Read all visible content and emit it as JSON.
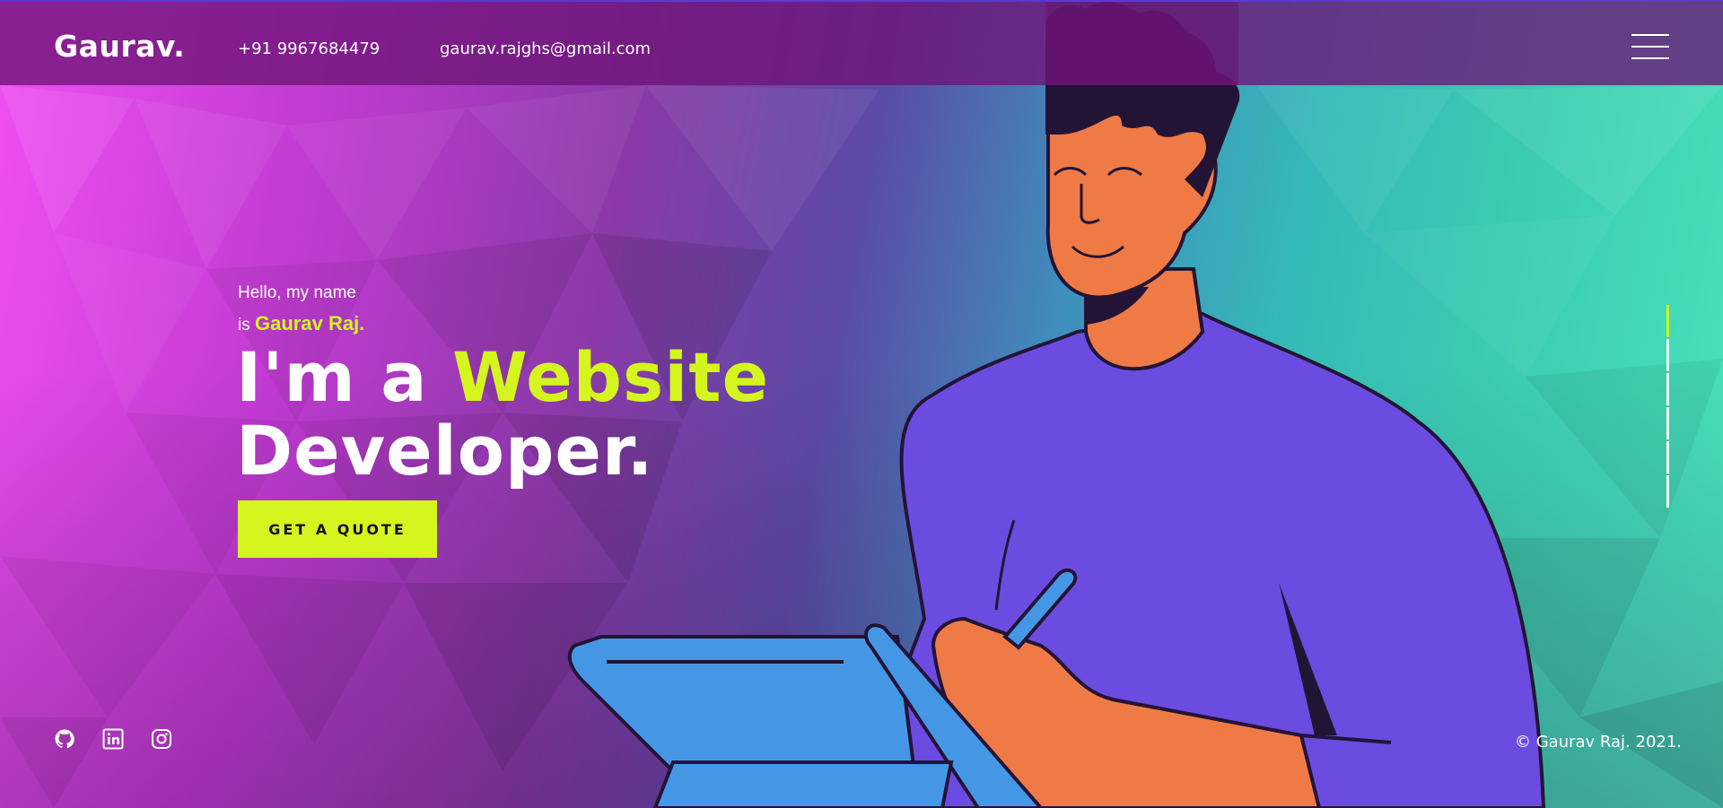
{
  "header": {
    "logo": "Gaurav.",
    "phone": "+91 9967684479",
    "email": "gaurav.rajghs@gmail.com",
    "menu_icon": "hamburger-icon"
  },
  "hero": {
    "greeting_line1": "Hello, my name",
    "greeting_is": "is",
    "greeting_name": "Gaurav Raj.",
    "headline_prefix": "I'm a",
    "headline_accent": "Website",
    "headline_line2": "Developer.",
    "cta_label": "GET A QUOTE"
  },
  "slider": {
    "segments": 6,
    "active_index": 0
  },
  "footer": {
    "social_icons": [
      "github-icon",
      "linkedin-icon",
      "instagram-icon"
    ],
    "copyright": "© Gaurav Raj. 2021."
  },
  "colors": {
    "accent": "#d4f51e",
    "header_bg": "#6e1478",
    "shirt": "#6c4be0",
    "skin": "#ef7a45",
    "hair": "#231436",
    "device": "#4597e6"
  }
}
